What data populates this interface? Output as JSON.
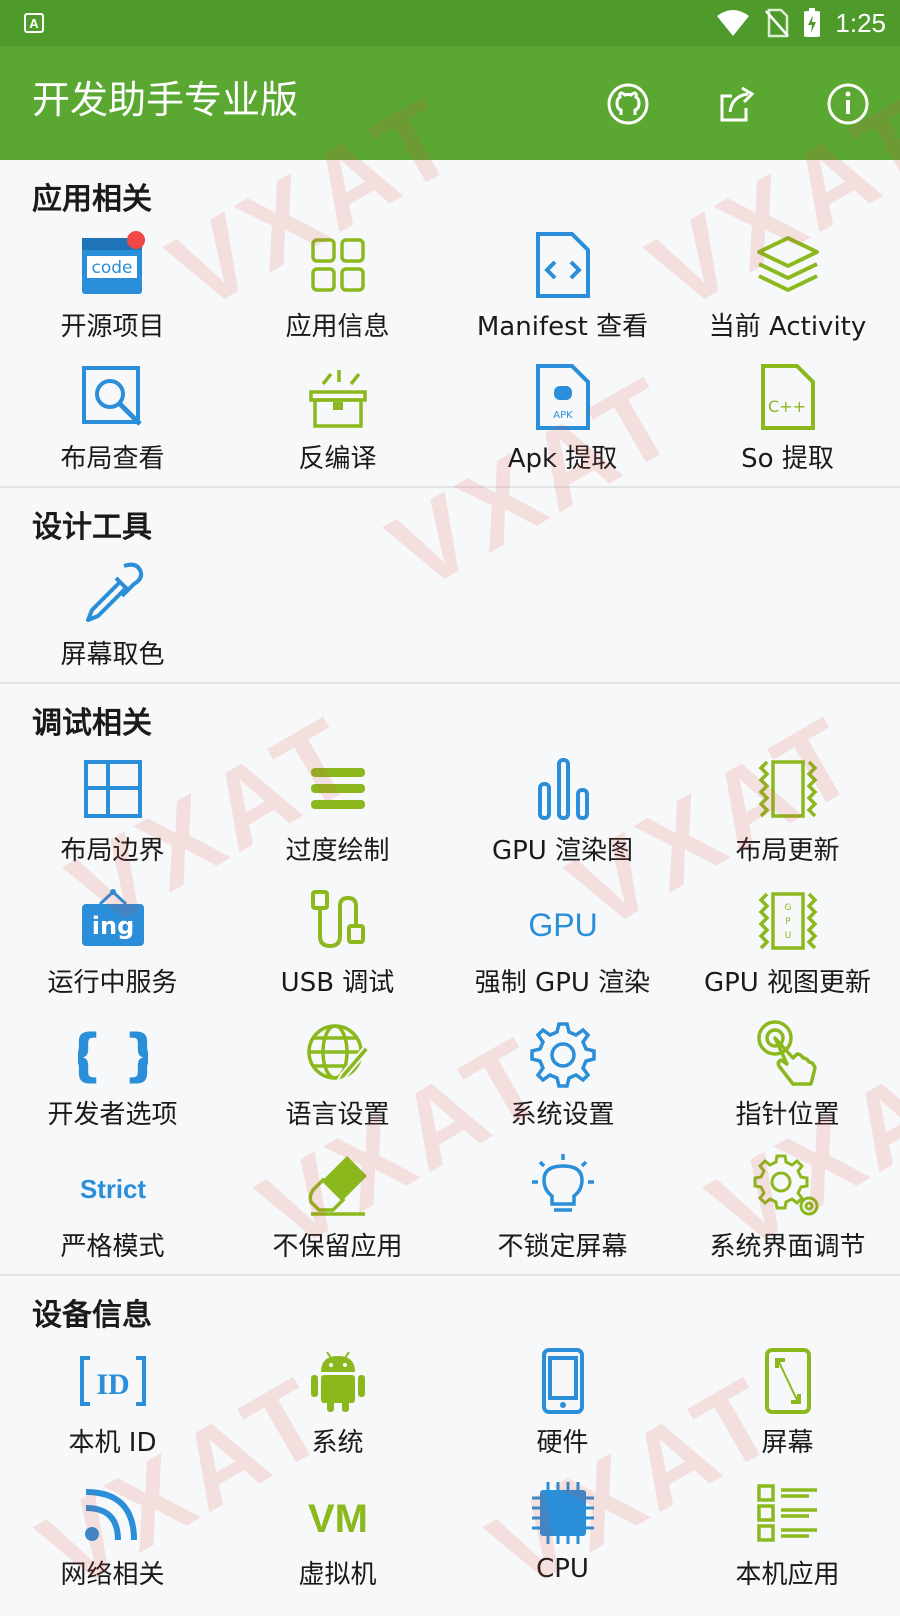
{
  "status_bar": {
    "time": "1:25"
  },
  "app_bar": {
    "title": "开发助手专业版"
  },
  "sections": [
    {
      "title": "应用相关",
      "items": [
        {
          "label": "开源项目",
          "icon": "code-icon"
        },
        {
          "label": "应用信息",
          "icon": "grid-icon"
        },
        {
          "label": "Manifest 查看",
          "icon": "manifest-icon"
        },
        {
          "label": "当前 Activity",
          "icon": "layers-icon"
        },
        {
          "label": "布局查看",
          "icon": "magnifier-icon"
        },
        {
          "label": "反编译",
          "icon": "box-icon"
        },
        {
          "label": "Apk 提取",
          "icon": "apk-icon"
        },
        {
          "label": "So 提取",
          "icon": "cpp-file-icon"
        }
      ]
    },
    {
      "title": "设计工具",
      "items": [
        {
          "label": "屏幕取色",
          "icon": "eyedropper-icon"
        }
      ]
    },
    {
      "title": "调试相关",
      "items": [
        {
          "label": "布局边界",
          "icon": "layout-bounds-icon"
        },
        {
          "label": "过度绘制",
          "icon": "overdraw-icon"
        },
        {
          "label": "GPU 渲染图",
          "icon": "bar-chart-icon"
        },
        {
          "label": "布局更新",
          "icon": "layout-update-icon"
        },
        {
          "label": "运行中服务",
          "icon": "ing-icon"
        },
        {
          "label": "USB 调试",
          "icon": "usb-icon"
        },
        {
          "label": "强制 GPU 渲染",
          "icon": "gpu-text-icon"
        },
        {
          "label": "GPU 视图更新",
          "icon": "gpu-view-icon"
        },
        {
          "label": "开发者选项",
          "icon": "braces-icon"
        },
        {
          "label": "语言设置",
          "icon": "globe-pen-icon"
        },
        {
          "label": "系统设置",
          "icon": "gear-icon"
        },
        {
          "label": "指针位置",
          "icon": "touch-icon"
        },
        {
          "label": "严格模式",
          "icon": "strict-icon"
        },
        {
          "label": "不保留应用",
          "icon": "eraser-icon"
        },
        {
          "label": "不锁定屏幕",
          "icon": "bulb-icon"
        },
        {
          "label": "系统界面调节",
          "icon": "gears-icon"
        }
      ]
    },
    {
      "title": "设备信息",
      "items": [
        {
          "label": "本机 ID",
          "icon": "id-icon"
        },
        {
          "label": "系统",
          "icon": "android-icon"
        },
        {
          "label": "硬件",
          "icon": "phone-icon"
        },
        {
          "label": "屏幕",
          "icon": "screen-icon"
        },
        {
          "label": "网络相关",
          "icon": "wifi-icon"
        },
        {
          "label": "虚拟机",
          "icon": "vm-icon"
        },
        {
          "label": "CPU",
          "icon": "cpu-icon"
        },
        {
          "label": "本机应用",
          "icon": "list-icon"
        }
      ]
    }
  ],
  "watermark": "VXAT",
  "colors": {
    "status_bar": "#4e9a2b",
    "app_bar": "#5aa832",
    "blue": "#2a8ed8",
    "green": "#8bb81d"
  }
}
